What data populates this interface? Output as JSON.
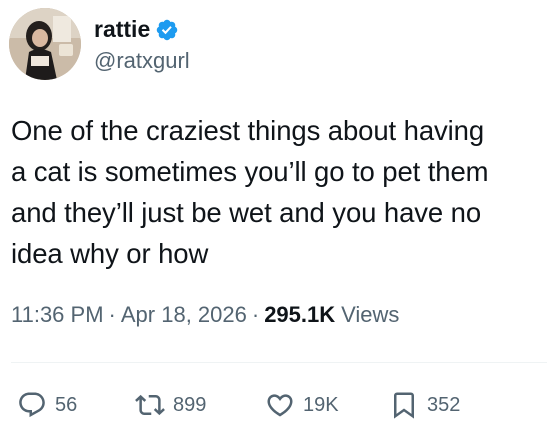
{
  "author": {
    "display_name": "rattie",
    "handle": "@ratxgurl",
    "verified": true,
    "verified_color": "#1d9bf0"
  },
  "tweet": {
    "lines": [
      "One of the craziest things about having",
      "a cat is sometimes you’ll go to pet them",
      "and they’ll just be wet and you have no",
      "idea why or how"
    ]
  },
  "meta": {
    "time": "11:36 PM",
    "separator": "·",
    "date": "Apr 18, 2026",
    "views_count": "295.1K",
    "views_label": "Views"
  },
  "actions": {
    "replies": {
      "icon": "reply-icon",
      "count": "56"
    },
    "retweets": {
      "icon": "retweet-icon",
      "count": "899"
    },
    "likes": {
      "icon": "heart-icon",
      "count": "19K"
    },
    "bookmarks": {
      "icon": "bookmark-icon",
      "count": "352"
    }
  },
  "colors": {
    "text_primary": "#0f1419",
    "text_secondary": "#536471",
    "divider": "#eff3f4"
  }
}
